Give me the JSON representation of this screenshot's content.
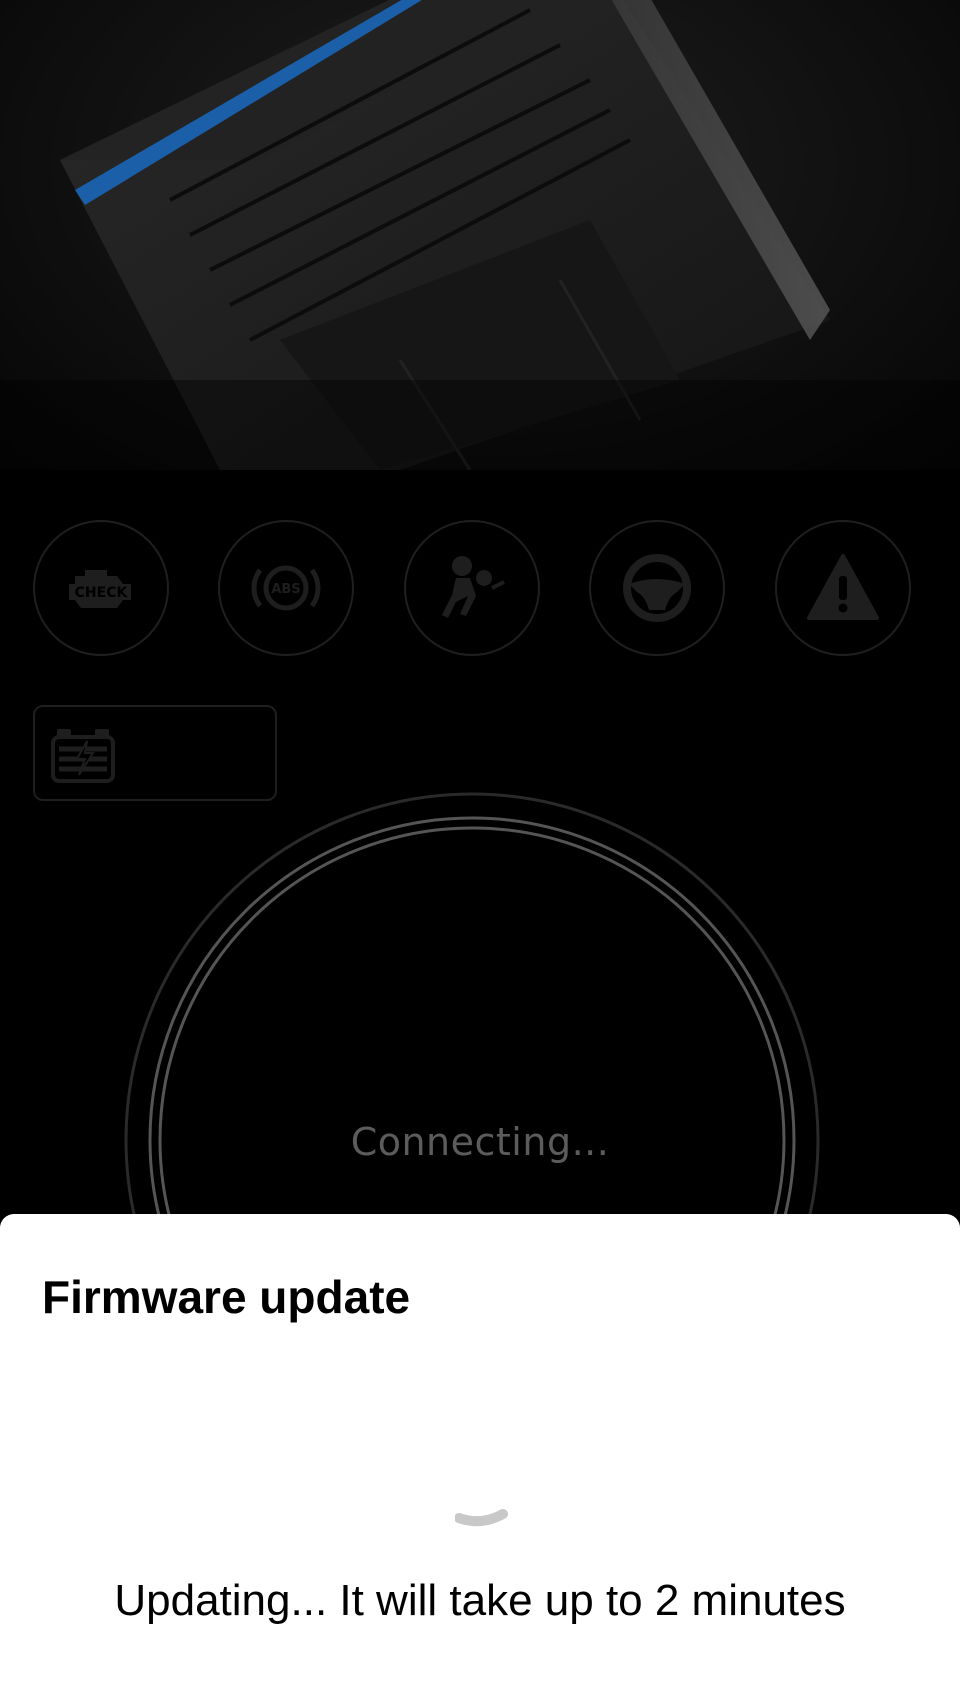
{
  "background": {
    "device_image": "obd-scanner-device-image"
  },
  "warning_lights": [
    {
      "icon": "check-engine-icon",
      "label": "CHECK"
    },
    {
      "icon": "abs-icon",
      "label": "ABS"
    },
    {
      "icon": "airbag-icon"
    },
    {
      "icon": "steering-wheel-icon"
    },
    {
      "icon": "warning-triangle-icon"
    }
  ],
  "battery": {
    "icon": "battery-icon"
  },
  "gauge": {
    "status_text": "Connecting..."
  },
  "sheet": {
    "title": "Firmware update",
    "message": "Updating... It will take up to 2 minutes"
  },
  "colors": {
    "accent_blue": "#1a5fa8",
    "sheet_bg": "#ffffff",
    "dim_icon": "#1e1e1e"
  }
}
